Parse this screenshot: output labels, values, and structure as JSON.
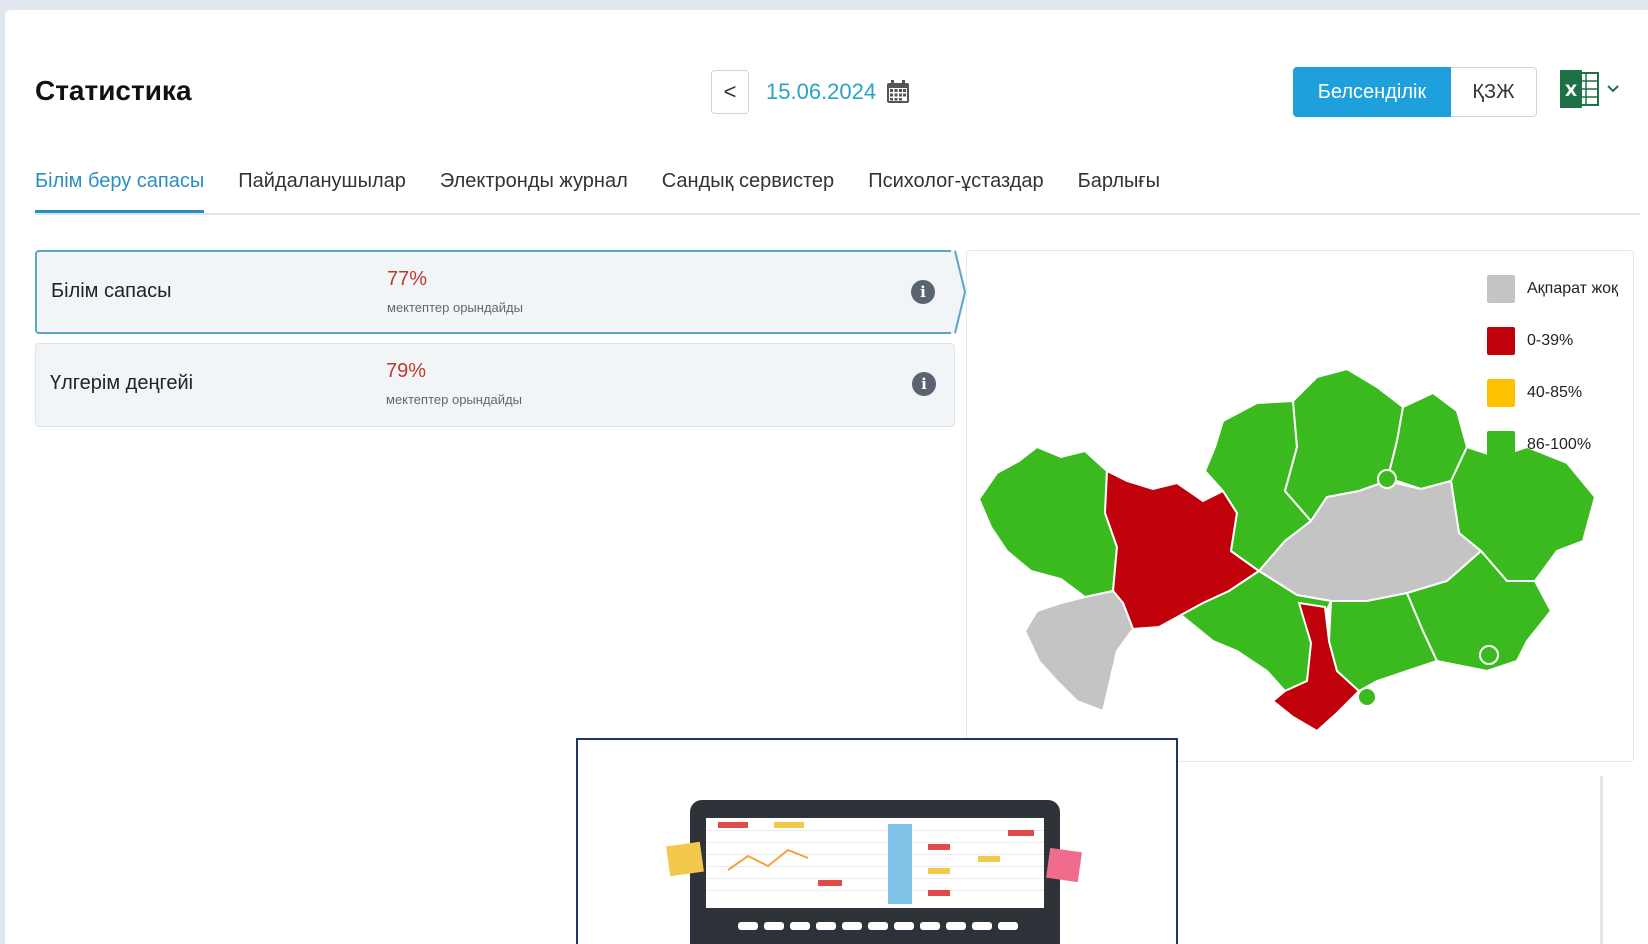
{
  "header": {
    "title": "Статистика",
    "prev_label": "<",
    "date": "15.06.2024",
    "toggle_active": "Белсенділік",
    "toggle_inactive": "ҚЗЖ"
  },
  "tabs": [
    {
      "label": "Білім беру сапасы",
      "active": true
    },
    {
      "label": "Пайдаланушылар",
      "active": false
    },
    {
      "label": "Электронды журнал",
      "active": false
    },
    {
      "label": "Сандық сервистер",
      "active": false
    },
    {
      "label": "Психолог-ұстаздар",
      "active": false
    },
    {
      "label": "Барлығы",
      "active": false
    }
  ],
  "cards": [
    {
      "label": "Білім сапасы",
      "percent": "77%",
      "sub": "мектептер орындайды",
      "selected": true
    },
    {
      "label": "Үлгерім деңгейі",
      "percent": "79%",
      "sub": "мектептер орындайды",
      "selected": false
    }
  ],
  "legend": [
    {
      "label": "Ақпарат жоқ",
      "color": "#c4c4c4"
    },
    {
      "label": "0-39%",
      "color": "#c0000a"
    },
    {
      "label": "40-85%",
      "color": "#ffc000"
    },
    {
      "label": "86-100%",
      "color": "#3aba1e"
    }
  ],
  "colors": {
    "accent": "#1da0dc",
    "date": "#2aa3c9",
    "percent": "#c0392b"
  }
}
